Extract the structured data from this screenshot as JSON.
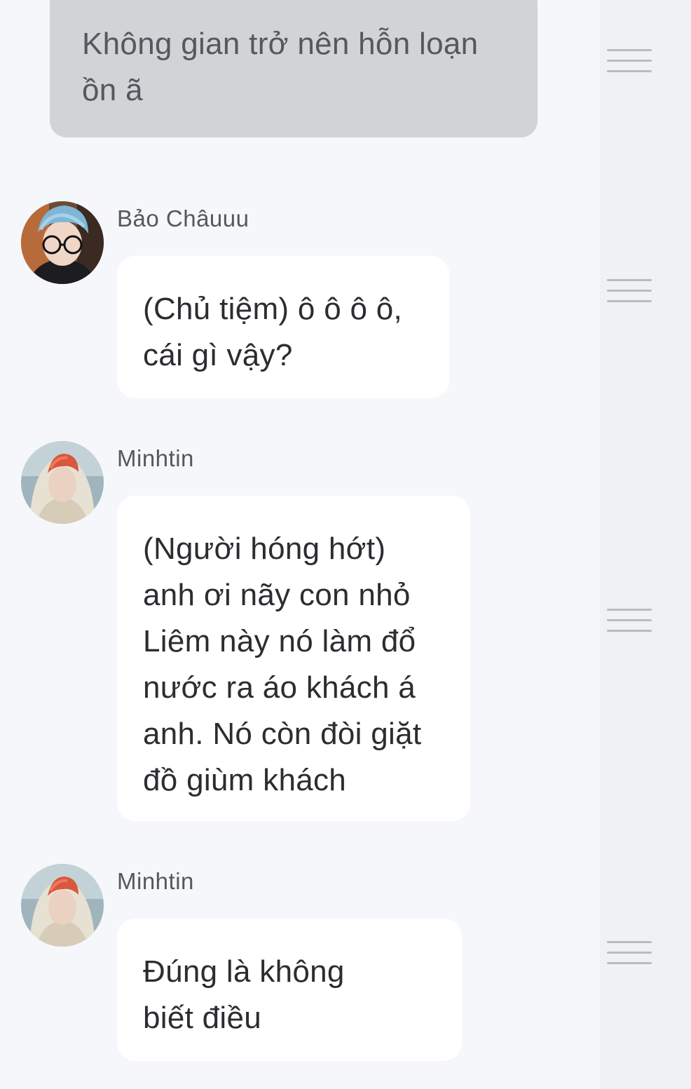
{
  "narration": {
    "lines": [
      "Không gian trở nên hỗn loạn",
      "ồn ã"
    ]
  },
  "messages": [
    {
      "sender": "Bảo Châuuu",
      "avatar_icon": "avatar-photo-blue-hair-glasses",
      "lines": [
        "(Chủ tiệm) ô ô ô ô,",
        "cái gì vậy?"
      ]
    },
    {
      "sender": "Minhtin",
      "avatar_icon": "avatar-photo-red-hair-hood",
      "lines": [
        "(Người hóng hớt)",
        "anh ơi nãy con nhỏ",
        "Liêm này nó làm đổ",
        "nước ra áo khách á",
        "anh. Nó còn đòi giặt",
        "đồ giùm khách"
      ]
    },
    {
      "sender": "Minhtin",
      "avatar_icon": "avatar-photo-red-hair-hood",
      "lines": [
        "Đúng là không",
        "biết điều"
      ]
    }
  ],
  "colors": {
    "background": "#f5f7fa",
    "narration_bubble": "#d1d3d6",
    "message_bubble": "#ffffff",
    "side_rail": "#f0f1f3",
    "handle": "#b9bbbe"
  },
  "icons": {
    "drag_handle": "drag-handle-icon"
  }
}
